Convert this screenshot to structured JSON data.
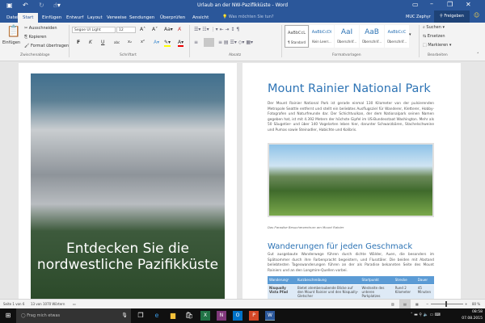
{
  "window": {
    "title": "Urlaub an der NW-Pazifikküste - Word",
    "user": "MUC Zephyr",
    "share": "Freigeben",
    "tell_me": "Was möchten Sie tun?"
  },
  "tabs": [
    "Datei",
    "Start",
    "Einfügen",
    "Entwurf",
    "Layout",
    "Verweise",
    "Sendungen",
    "Überprüfen",
    "Ansicht"
  ],
  "ribbon": {
    "clipboard": {
      "paste": "Einfügen",
      "cut": "Ausschneiden",
      "copy": "Kopieren",
      "format_painter": "Format übertragen",
      "group": "Zwischenablage"
    },
    "font": {
      "name": "Segoe UI Light",
      "size": "12",
      "group": "Schriftart",
      "bold": "F",
      "italic": "K",
      "underline": "U"
    },
    "paragraph": {
      "group": "Absatz"
    },
    "styles": {
      "items": [
        {
          "preview": "AaBbCcL",
          "label": "¶ Standard"
        },
        {
          "preview": "AaBbCcDi",
          "label": "Kein Leerr..."
        },
        {
          "preview": "AaI",
          "label": "Überschrif..."
        },
        {
          "preview": "AaB",
          "label": "Überschrif..."
        },
        {
          "preview": "AaBbCcC",
          "label": "Überschrif..."
        }
      ],
      "group": "Formatvorlagen"
    },
    "editing": {
      "find": "Suchen",
      "replace": "Ersetzen",
      "select": "Markieren",
      "group": "Bearbeiten"
    }
  },
  "cover": {
    "text": "Entdecken Sie die nordwestliche Pazifikküste"
  },
  "doc": {
    "title": "Mount Rainier National Park",
    "intro": "Der Mount Rainier National Park ist gerade einmal 130 Kilometer von der pulsierenden Metropole Seattle entfernt und stellt ein beliebtes Ausflugsziel für Wanderer, Kletterer, Hobby-Fotografen und Naturfreunde dar. Der Schichtvulkan, der dem Nationalpark seinen Namen gegeben hat, ist mit 4.392 Metern der höchste Gipfel im US-Bundesstaat Washington. Mehr als 50 Säugetier- und über 140 Vogelarten leben hier, darunter Schwarzbären, Stachelschweine und Pumas sowie Steinadler, Habichte und Kolibris.",
    "caption": "Das Paradise Besucherzentrum am Mount Rainier",
    "heading2": "Wanderungen für jeden Geschmack",
    "para2": "Gut ausgebaute Wanderwege führen durch dichte Wälder, Auen, die besonders im Spätsommer durch ihre Farbenpracht begeistern, und Flusstäler. Die beiden mit Abstand beliebtesten Tageswanderungen führen an der als Paradise bekannten Seite des Mount Rainiers und an den Longmire-Quellen vorbei.",
    "table": {
      "headers": [
        "Wanderung¹",
        "Kurzbeschreibung",
        "Startpunkt",
        "Strecke",
        "Dauer"
      ],
      "rows": [
        [
          "Nisqually Vista Pfad",
          "Bietet atemberaubende Blicke auf den Mount Rainier und den Nisqually-Gletscher",
          "Westseite des unteren Parkplatzes",
          "Rund 2 Kilometer",
          "45 Minuten"
        ]
      ]
    }
  },
  "status": {
    "page": "Seite 1 von 6",
    "words": "13 von 1070 Wörtern",
    "zoom": "80 %"
  },
  "taskbar": {
    "search": "Frag mich etwas",
    "time": "08:58",
    "date": "07.08.2015"
  },
  "colors": {
    "brand": "#2b579a",
    "heading": "#2e74b5",
    "table_header": "#5b9bd5"
  }
}
